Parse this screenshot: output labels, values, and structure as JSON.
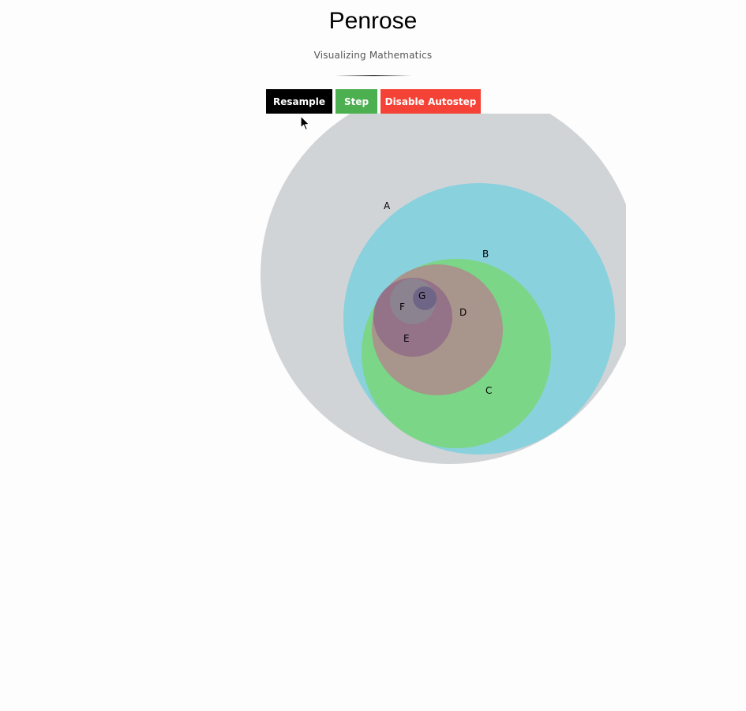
{
  "header": {
    "title": "Penrose",
    "subtitle": "Visualizing Mathematics"
  },
  "toolbar": {
    "resample_label": "Resample",
    "step_label": "Step",
    "autostep_label": "Disable Autostep",
    "colors": {
      "resample": "#000000",
      "step": "#4caf50",
      "autostep": "#f44336"
    }
  },
  "diagram": {
    "sets": [
      {
        "label": "A",
        "color": "#d1d4d7"
      },
      {
        "label": "B",
        "color": "#83d0de"
      },
      {
        "label": "C",
        "color": "#7ad67f"
      },
      {
        "label": "D",
        "color": "#ab8f8b"
      },
      {
        "label": "E",
        "color": "#936f88"
      },
      {
        "label": "F",
        "color": "#8b8490"
      },
      {
        "label": "G",
        "color": "#6c6487"
      }
    ]
  },
  "cursor": {
    "icon": "mouse-pointer-icon"
  }
}
